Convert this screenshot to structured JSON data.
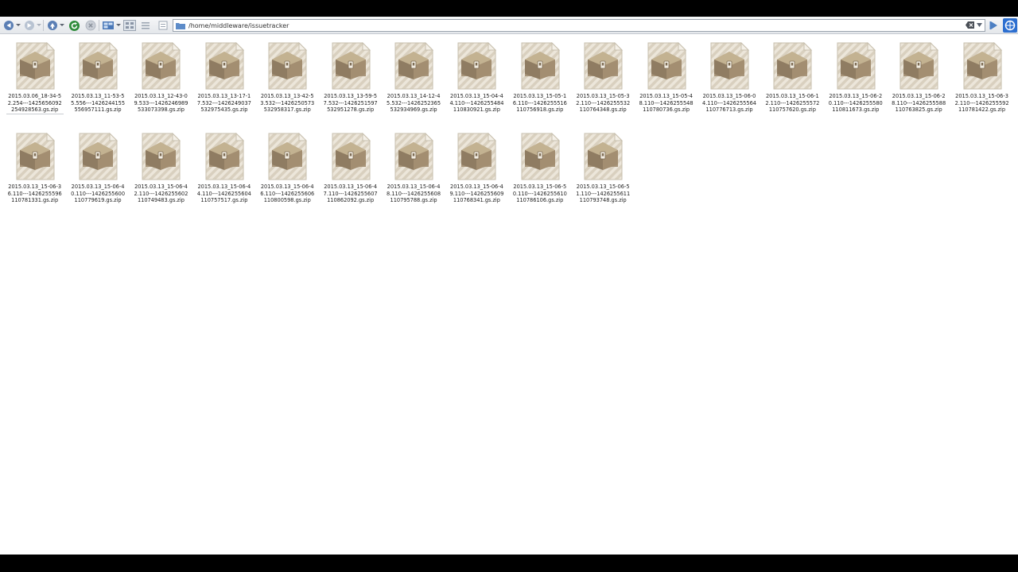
{
  "toolbar": {
    "back_icon": "back-arrow-icon",
    "forward_icon": "forward-arrow-icon",
    "up_icon": "up-arrow-icon",
    "reload_icon": "reload-icon",
    "stop_icon": "stop-icon",
    "view_mode_icon": "view-mode-icon",
    "address": "/home/middleware/issuetracker",
    "accent_color": "#2e8b3a"
  },
  "files": [
    {
      "name": "2015.03.06_18-34-52.254---1425656092254928563.gs.zip"
    },
    {
      "name": "2015.03.13_11-53-55.556---1426244155556957111.gs.zip"
    },
    {
      "name": "2015.03.13_12-43-09.533---1426246989533073398.gs.zip"
    },
    {
      "name": "2015.03.13_13-17-17.532---1426249037532975435.gs.zip"
    },
    {
      "name": "2015.03.13_13-42-53.532---1426250573532958317.gs.zip"
    },
    {
      "name": "2015.03.13_13-59-57.532---1426251597532951278.gs.zip"
    },
    {
      "name": "2015.03.13_14-12-45.532---1426252365532934969.gs.zip"
    },
    {
      "name": "2015.03.13_15-04-44.110---1426255484110830921.gs.zip"
    },
    {
      "name": "2015.03.13_15-05-16.110---1426255516110756918.gs.zip"
    },
    {
      "name": "2015.03.13_15-05-32.110---1426255532110764348.gs.zip"
    },
    {
      "name": "2015.03.13_15-05-48.110---1426255548110780736.gs.zip"
    },
    {
      "name": "2015.03.13_15-06-04.110---1426255564110776713.gs.zip"
    },
    {
      "name": "2015.03.13_15-06-12.110---1426255572110757620.gs.zip"
    },
    {
      "name": "2015.03.13_15-06-20.110---1426255580110811673.gs.zip"
    },
    {
      "name": "2015.03.13_15-06-28.110---1426255588110763825.gs.zip"
    },
    {
      "name": "2015.03.13_15-06-32.110---1426255592110781422.gs.zip"
    },
    {
      "name": "2015.03.13_15-06-36.110---1426255596110781331.gs.zip"
    },
    {
      "name": "2015.03.13_15-06-40.110---1426255600110779619.gs.zip"
    },
    {
      "name": "2015.03.13_15-06-42.110---1426255602110749483.gs.zip"
    },
    {
      "name": "2015.03.13_15-06-44.110---1426255604110757517.gs.zip"
    },
    {
      "name": "2015.03.13_15-06-46.110---1426255606110800598.gs.zip"
    },
    {
      "name": "2015.03.13_15-06-47.110---1426255607110862092.gs.zip"
    },
    {
      "name": "2015.03.13_15-06-48.110---1426255608110795788.gs.zip"
    },
    {
      "name": "2015.03.13_15-06-49.110---1426255609110768341.gs.zip"
    },
    {
      "name": "2015.03.13_15-06-50.110---1426255610110786106.gs.zip"
    },
    {
      "name": "2015.03.13_15-06-51.110---1426255611110793748.gs.zip"
    }
  ]
}
